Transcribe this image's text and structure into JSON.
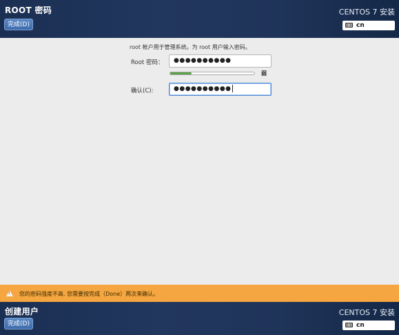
{
  "top_header": {
    "title": "ROOT 密码",
    "done_label": "完成(D)",
    "product": "CENTOS 7 安装",
    "keyboard_layout": "cn"
  },
  "form": {
    "description": "root 帐户用于管理系统。为 root 用户输入密码。",
    "password_label": "Root 密码：",
    "password_value": "●●●●●●●●●●",
    "strength_fraction": 0.25,
    "strength_text": "弱",
    "confirm_label": "确认(C):",
    "confirm_value": "●●●●●●●●●●"
  },
  "warning": {
    "text": "您的密码强度不高. 您需要按完成（Done）两次来确认。"
  },
  "bottom_header": {
    "title": "创建用户",
    "done_label": "完成(D)",
    "product": "CENTOS 7 安装",
    "keyboard_layout": "cn"
  }
}
